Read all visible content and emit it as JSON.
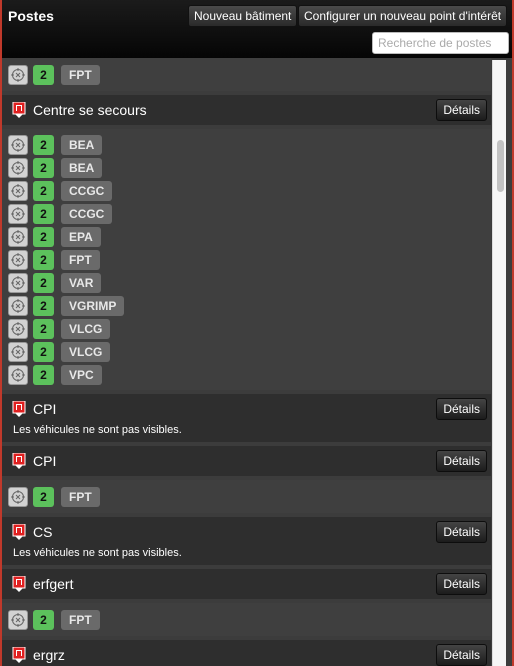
{
  "header": {
    "title": "Postes",
    "new_building_label": "Nouveau bâtiment",
    "configure_poi_label": "Configurer un nouveau point d'intérêt",
    "search_placeholder": "Recherche de postes"
  },
  "details_label": "Détails",
  "invisible_note": "Les véhicules ne sont pas visibles.",
  "top_group": [
    {
      "count": "2",
      "type": "FPT"
    }
  ],
  "buildings": [
    {
      "name": "Centre se secours",
      "vehicles": [
        {
          "count": "2",
          "type": "BEA"
        },
        {
          "count": "2",
          "type": "BEA"
        },
        {
          "count": "2",
          "type": "CCGC"
        },
        {
          "count": "2",
          "type": "CCGC"
        },
        {
          "count": "2",
          "type": "EPA"
        },
        {
          "count": "2",
          "type": "FPT"
        },
        {
          "count": "2",
          "type": "VAR"
        },
        {
          "count": "2",
          "type": "VGRIMP"
        },
        {
          "count": "2",
          "type": "VLCG"
        },
        {
          "count": "2",
          "type": "VLCG"
        },
        {
          "count": "2",
          "type": "VPC"
        }
      ]
    },
    {
      "name": "CPI",
      "vehicles_visible": false,
      "vehicles": []
    },
    {
      "name": "CPI",
      "vehicles": [
        {
          "count": "2",
          "type": "FPT"
        }
      ]
    },
    {
      "name": "CS",
      "vehicles_visible": false,
      "vehicles": []
    },
    {
      "name": "erfgert",
      "vehicles": [
        {
          "count": "2",
          "type": "FPT"
        }
      ]
    },
    {
      "name": "ergrz",
      "vehicles": []
    }
  ],
  "colors": {
    "count_badge": "#5cc15c",
    "building_icon": "#e02020",
    "frame": "#c0392b"
  }
}
